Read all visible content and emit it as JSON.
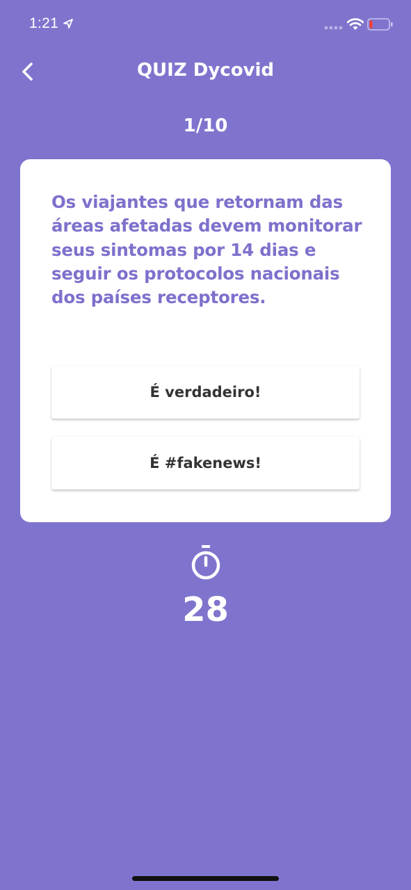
{
  "status_bar": {
    "time": "1:21",
    "icons": [
      "location-icon",
      "signal-icon",
      "wifi-icon",
      "battery-icon"
    ]
  },
  "header": {
    "title": "QUIZ Dycovid",
    "back_icon": "chevron-left-icon"
  },
  "quiz": {
    "progress": "1/10",
    "question": "Os viajantes que retornam das áreas afetadas devem monitorar seus sintomas por 14 dias e seguir os protocolos nacionais dos países receptores.",
    "answers": {
      "true_label": "É verdadeiro!",
      "fake_label": "É #fakenews!"
    }
  },
  "timer": {
    "icon": "stopwatch-icon",
    "seconds": "28"
  },
  "colors": {
    "background": "#7f74cd",
    "accent_text": "#7d71cc",
    "card": "#ffffff",
    "button_text": "#333333"
  }
}
